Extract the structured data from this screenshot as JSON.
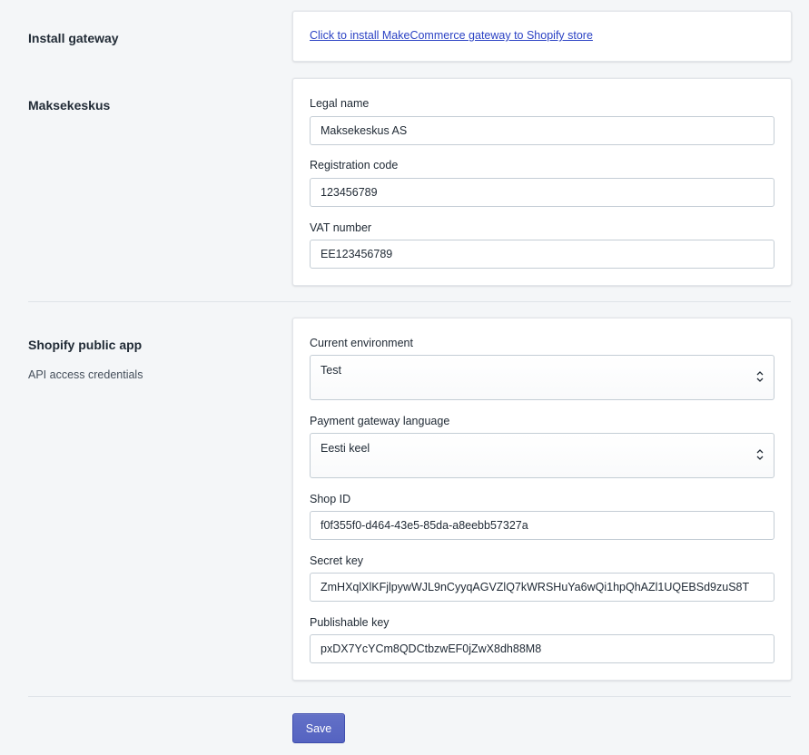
{
  "install_section": {
    "title": "Install gateway",
    "link_text": "Click to install MakeCommerce gateway to Shopify store"
  },
  "company_section": {
    "title": "Maksekeskus",
    "fields": [
      {
        "label": "Legal name",
        "value": "Maksekeskus AS"
      },
      {
        "label": "Registration code",
        "value": "123456789"
      },
      {
        "label": "VAT number",
        "value": "EE123456789"
      }
    ]
  },
  "app_section": {
    "title": "Shopify public app",
    "description": "API access credentials",
    "environment": {
      "label": "Current environment",
      "selected": "Test"
    },
    "language": {
      "label": "Payment gateway language",
      "selected": "Eesti keel"
    },
    "shop_id": {
      "label": "Shop ID",
      "value": "f0f355f0-d464-43e5-85da-a8eebb57327a"
    },
    "secret_key": {
      "label": "Secret key",
      "value": "ZmHXqlXlKFjlpywWJL9nCyyqAGVZlQ7kWRSHuYa6wQi1hpQhAZl1UQEBSd9zuS8T"
    },
    "publishable_key": {
      "label": "Publishable key",
      "value": "pxDX7YcYCm8QDCtbzwEF0jZwX8dh88M8"
    }
  },
  "actions": {
    "save_label": "Save"
  },
  "colors": {
    "primary": "#5c6ac4",
    "link": "#2b42c4",
    "background": "#f4f6f8"
  },
  "icons": {
    "select_caret": "select-caret-icon"
  }
}
